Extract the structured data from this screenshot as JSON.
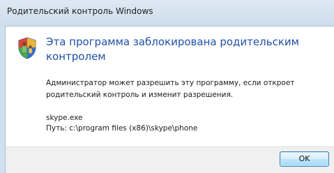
{
  "window": {
    "title": "Родительский контроль Windows"
  },
  "dialog": {
    "icon": "parental-control-shield-icon",
    "heading": "Эта программа заблокирована родительским контролем",
    "message": "Администратор может разрешить эту программу, если откроет родительский контроль и изменит разрешения.",
    "program_name": "skype.exe",
    "program_path": "Путь: c:\\program files (x86)\\skype\\phone"
  },
  "buttons": {
    "ok_label": "OK"
  },
  "colors": {
    "heading": "#1f4fa6",
    "titlebar": "#d6e3f0",
    "footer": "#f0f0f0"
  }
}
